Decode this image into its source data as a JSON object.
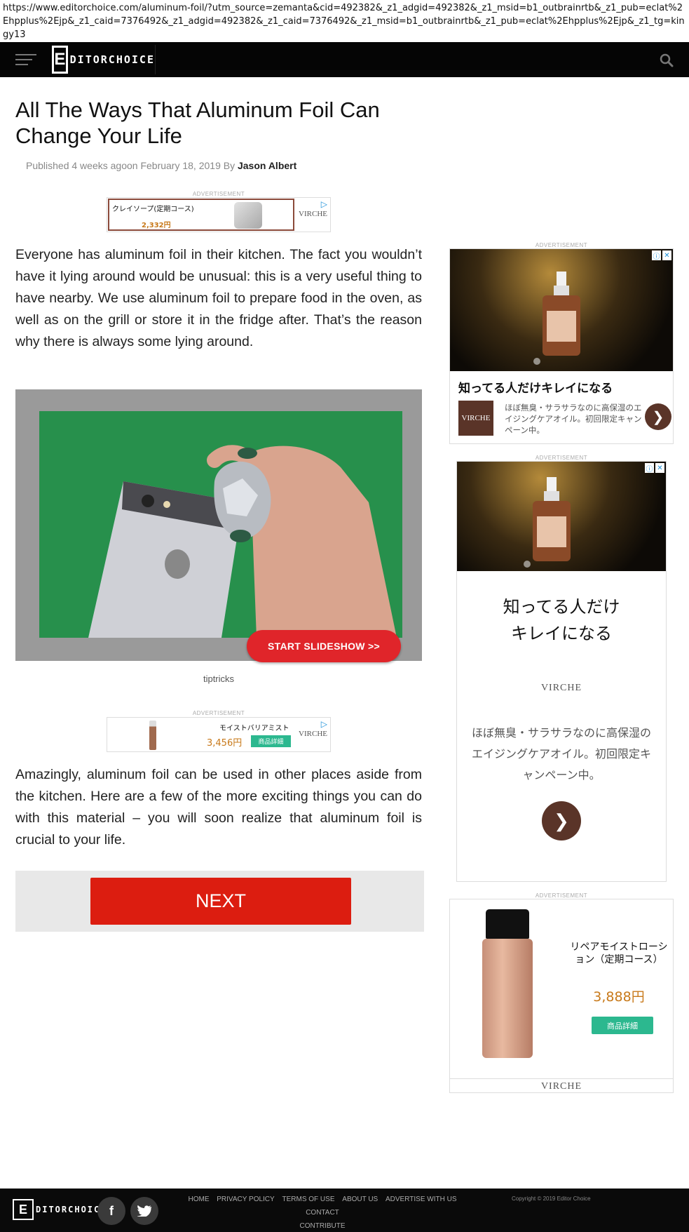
{
  "url": "https://www.editorchoice.com/aluminum-foil/?utm_source=zemanta&cid=492382&_z1_adgid=492382&_z1_msid=b1_outbrainrtb&_z1_pub=eclat%2Ehpplus%2Ejp&_z1_caid=7376492&_z1_adgid=492382&_z1_caid=7376492&_z1_msid=b1_outbrainrtb&_z1_pub=eclat%2Ehpplus%2Ejp&_z1_tg=kingy13",
  "nav": {
    "logo_letter": "E",
    "logo_text": "DITORCHOICE"
  },
  "article": {
    "title": "All The Ways That Aluminum Foil Can Change Your Life",
    "published": "Published 4 weeks agoon February 18, 2019 By ",
    "author": "Jason Albert",
    "para1": "Everyone has aluminum foil in their kitchen. The fact you wouldn’t have it lying around would be unusual: this is a very useful thing to have nearby. We use aluminum foil to prepare food in the oven, as well as on the grill or store it in the fridge after. That’s the reason why there is always some lying around.",
    "slideshow_label": "START SLIDESHOW >>",
    "caption": "tiptricks",
    "para2": "Amazingly, aluminum foil can be used in other places aside from the kitchen. Here are a few of the more exciting things you can do with this material – you will soon realize that aluminum foil is crucial to your life.",
    "next_label": "NEXT"
  },
  "ads": {
    "label": "ADVERTISEMENT",
    "banner1": {
      "product": "クレイソープ(定期コース)",
      "price": "2,332円",
      "brand": "VIRCHE"
    },
    "banner2": {
      "product": "モイストバリアミスト",
      "price": "3,456円",
      "button": "商品詳細",
      "brand": "VIRCHE"
    },
    "side1": {
      "title": "知ってる人だけキレイになる",
      "logo": "VIRCHE",
      "desc": "ほぼ無臭・サラサラなのに高保湿のエイジングケアオイル。初回限定キャンペーン中。"
    },
    "side2": {
      "headline_line1": "知ってる人だけ",
      "headline_line2": "キレイになる",
      "brand": "VIRCHE",
      "desc": "ほぼ無臭・サラサラなのに高保湿のエイジングケアオイル。初回限定キャンペーン中。"
    },
    "side3": {
      "product": "リペアモイストローション（定期コース）",
      "price": "3,888円",
      "button": "商品詳細",
      "brand": "VIRCHE"
    }
  },
  "footer": {
    "logo_letter": "E",
    "logo_text": "DITORCHOICE",
    "facebook": "f",
    "links": [
      "HOME",
      "PRIVACY POLICY",
      "TERMS OF USE",
      "ABOUT US",
      "ADVERTISE WITH US",
      "CONTACT",
      "CONTRIBUTE"
    ],
    "copyright": "Copyright © 2019 Editor Choice"
  },
  "colors": {
    "next_red": "#dc1d10",
    "slideshow_red": "#e0252a",
    "price_orange": "#c8791a",
    "detail_green": "#2cb88f",
    "virche_brown": "#5a3428"
  },
  "icons": [
    "hamburger-icon",
    "search-icon",
    "adchoices-icon",
    "close-icon",
    "chevron-right-icon",
    "facebook-icon",
    "twitter-icon"
  ]
}
